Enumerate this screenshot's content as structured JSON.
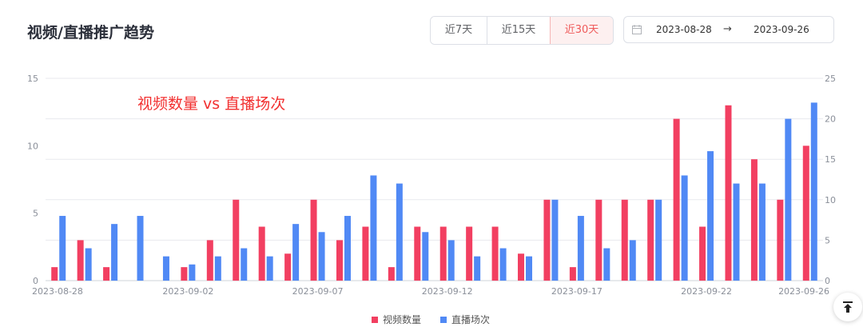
{
  "header": {
    "title": "视频/直播推广趋势"
  },
  "range_buttons": [
    {
      "label": "近7天",
      "active": false
    },
    {
      "label": "近15天",
      "active": false
    },
    {
      "label": "近30天",
      "active": true
    }
  ],
  "date_range": {
    "start": "2023-08-28",
    "separator": "→",
    "end": "2023-09-26"
  },
  "colors": {
    "video": "#f23f61",
    "live": "#5089f5",
    "annotation": "#f23030",
    "active_button": "#ef5a5a"
  },
  "chart_data": {
    "type": "bar",
    "title": "",
    "annotation": "视频数量 vs 直播场次",
    "categories": [
      "2023-08-28",
      "2023-08-29",
      "2023-08-30",
      "2023-08-31",
      "2023-09-01",
      "2023-09-02",
      "2023-09-03",
      "2023-09-04",
      "2023-09-05",
      "2023-09-06",
      "2023-09-07",
      "2023-09-08",
      "2023-09-09",
      "2023-09-10",
      "2023-09-11",
      "2023-09-12",
      "2023-09-13",
      "2023-09-14",
      "2023-09-15",
      "2023-09-16",
      "2023-09-17",
      "2023-09-18",
      "2023-09-19",
      "2023-09-20",
      "2023-09-21",
      "2023-09-22",
      "2023-09-23",
      "2023-09-24",
      "2023-09-25",
      "2023-09-26"
    ],
    "x_tick_labels": [
      "2023-08-28",
      "2023-09-02",
      "2023-09-07",
      "2023-09-12",
      "2023-09-17",
      "2023-09-22",
      "2023-09-26"
    ],
    "series": [
      {
        "name": "视频数量",
        "axis": "left",
        "values": [
          1,
          3,
          1,
          0,
          0,
          1,
          3,
          6,
          4,
          2,
          6,
          3,
          4,
          1,
          4,
          4,
          4,
          4,
          2,
          6,
          1,
          6,
          6,
          6,
          12,
          4,
          13,
          9,
          6,
          10
        ]
      },
      {
        "name": "直播场次",
        "axis": "right",
        "values": [
          8,
          4,
          7,
          8,
          3,
          2,
          3,
          4,
          3,
          7,
          6,
          8,
          13,
          12,
          6,
          5,
          3,
          4,
          3,
          10,
          8,
          4,
          5,
          10,
          13,
          16,
          12,
          12,
          20,
          22
        ]
      }
    ],
    "y_left": {
      "min": 0,
      "max": 15,
      "ticks": [
        0,
        5,
        10,
        15
      ]
    },
    "y_right": {
      "min": 0,
      "max": 25,
      "ticks": [
        0,
        5,
        10,
        15,
        20,
        25
      ]
    },
    "grid": true,
    "legend_position": "bottom-center"
  }
}
